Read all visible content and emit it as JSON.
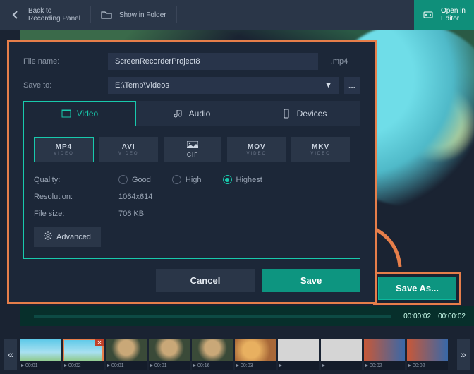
{
  "topbar": {
    "back": "Back to\nRecording Panel",
    "show_folder": "Show in Folder",
    "open_editor": "Open in\nEditor"
  },
  "player": {
    "time_left": "00:00:02",
    "time_right": "00:00:02"
  },
  "save_as_label": "Save As...",
  "dialog": {
    "filename_label": "File name:",
    "filename_value": "ScreenRecorderProject8",
    "ext": ".mp4",
    "saveto_label": "Save to:",
    "saveto_value": "E:\\Temp\\Videos",
    "browse": "...",
    "tabs": {
      "video": "Video",
      "audio": "Audio",
      "devices": "Devices"
    },
    "formats": {
      "mp4": {
        "name": "MP4",
        "sub": "VIDEO"
      },
      "avi": {
        "name": "AVI",
        "sub": "VIDEO"
      },
      "gif": {
        "name": "GIF",
        "sub": ""
      },
      "mov": {
        "name": "MOV",
        "sub": "VIDEO"
      },
      "mkv": {
        "name": "MKV",
        "sub": "VIDEO"
      }
    },
    "quality_label": "Quality:",
    "quality": {
      "good": "Good",
      "high": "High",
      "highest": "Highest"
    },
    "resolution_label": "Resolution:",
    "resolution_value": "1064x614",
    "filesize_label": "File size:",
    "filesize_value": "706 KB",
    "advanced": "Advanced",
    "cancel": "Cancel",
    "save": "Save"
  },
  "thumbs": [
    {
      "dur": "00:01",
      "kind": "sky"
    },
    {
      "dur": "00:02",
      "kind": "sky",
      "selected": true,
      "closable": true
    },
    {
      "dur": "00:01",
      "kind": "dog"
    },
    {
      "dur": "00:01",
      "kind": "dog"
    },
    {
      "dur": "00:16",
      "kind": "dog"
    },
    {
      "dur": "00:03",
      "kind": "food"
    },
    {
      "dur": "",
      "kind": "blank"
    },
    {
      "dur": "",
      "kind": "blank"
    },
    {
      "dur": "00:02",
      "kind": "people"
    },
    {
      "dur": "00:02",
      "kind": "people"
    }
  ]
}
